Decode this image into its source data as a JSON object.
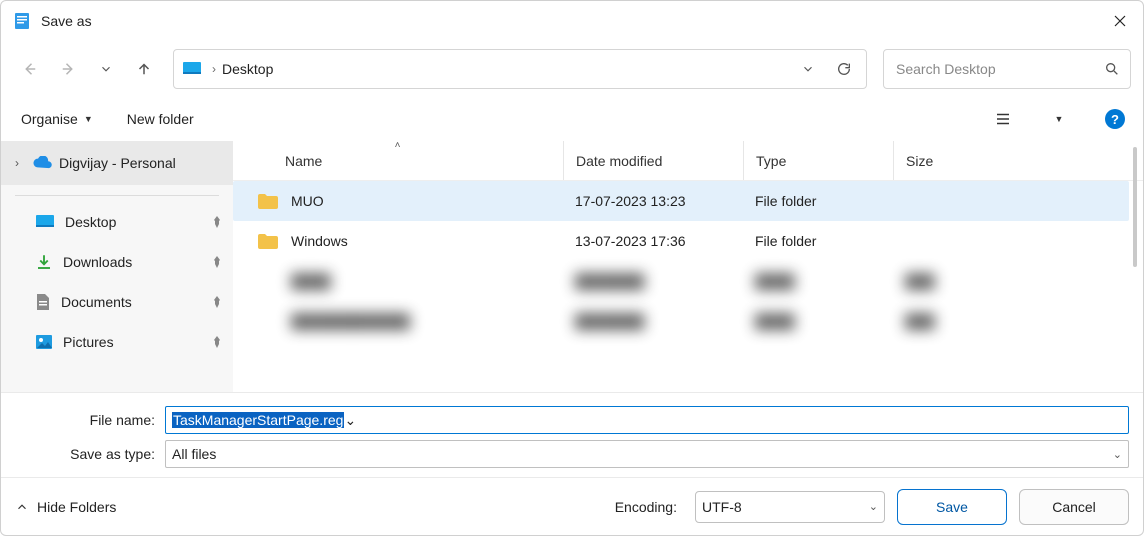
{
  "window": {
    "title": "Save as"
  },
  "nav": {
    "location": "Desktop"
  },
  "search": {
    "placeholder": "Search Desktop"
  },
  "toolbar": {
    "organise_label": "Organise",
    "newfolder_label": "New folder"
  },
  "sidebar": {
    "group_label": "Digvijay - Personal",
    "items": [
      {
        "label": "Desktop",
        "icon": "desktop"
      },
      {
        "label": "Downloads",
        "icon": "download"
      },
      {
        "label": "Documents",
        "icon": "document"
      },
      {
        "label": "Pictures",
        "icon": "pictures"
      }
    ]
  },
  "columns": {
    "name": "Name",
    "date": "Date modified",
    "type": "Type",
    "size": "Size"
  },
  "files": [
    {
      "name": "MUO",
      "date": "17-07-2023 13:23",
      "type": "File folder",
      "size": "",
      "selected": true
    },
    {
      "name": "Windows",
      "date": "13-07-2023 17:36",
      "type": "File folder",
      "size": "",
      "selected": false
    }
  ],
  "form": {
    "filename_label": "File name:",
    "filename_value": "TaskManagerStartPage.reg",
    "saveastype_label": "Save as type:",
    "saveastype_value": "All files"
  },
  "footer": {
    "hidefolders_label": "Hide Folders",
    "encoding_label": "Encoding:",
    "encoding_value": "UTF-8",
    "save_label": "Save",
    "cancel_label": "Cancel"
  }
}
